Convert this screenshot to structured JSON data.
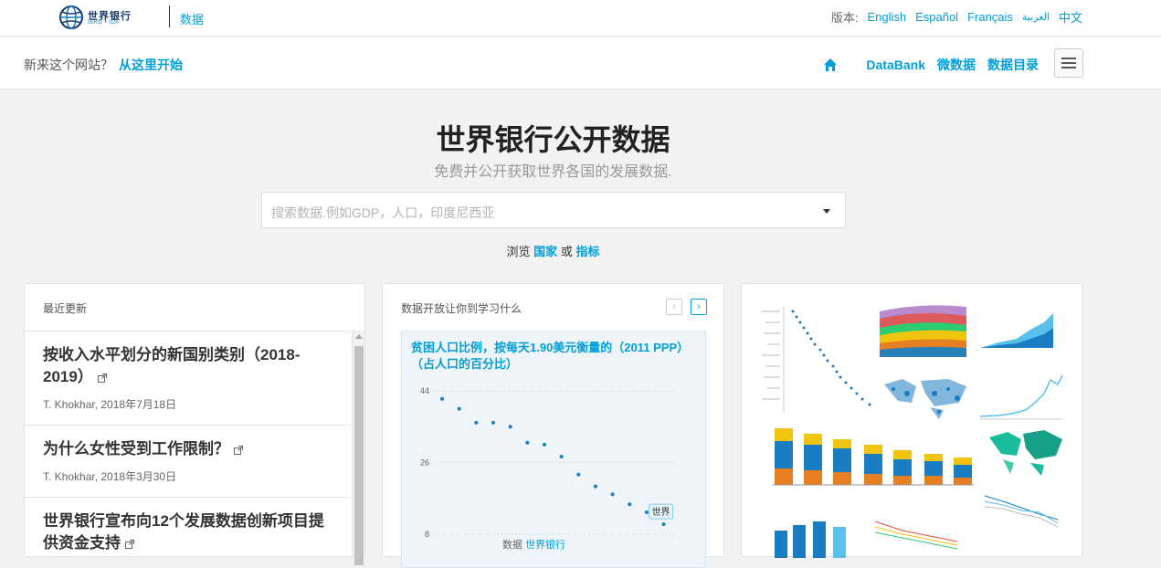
{
  "header": {
    "logo_name": "世界银行",
    "logo_sub": "IBRD • IDA",
    "site_name": "数据",
    "version_label": "版本:",
    "languages": [
      "English",
      "Español",
      "Français",
      "العربية",
      "中文"
    ]
  },
  "subnav": {
    "new_prefix": "新来这个网站？",
    "new_link": "从这里开始",
    "links": [
      "DataBank",
      "微数据",
      "数据目录"
    ]
  },
  "hero": {
    "title": "世界银行公开数据",
    "subtitle": "免费并公开获取世界各国的发展数据.",
    "search_placeholder": "搜索数据.例如GDP，人口，印度尼西亚",
    "browse_prefix": "浏览",
    "browse_countries": "国家",
    "browse_or": "或",
    "browse_indicators": "指标"
  },
  "recent": {
    "heading": "最近更新",
    "items": [
      {
        "title": "按收入水平划分的新国别类别（2018-2019）",
        "meta": "T. Khokhar, 2018年7月18日"
      },
      {
        "title": "为什么女性受到工作限制？",
        "meta": "T. Khokhar, 2018年3月30日"
      },
      {
        "title": "世界银行宣布向12个发展数据创新项目提供资金支持",
        "meta": ""
      }
    ]
  },
  "learn": {
    "heading": "数据开放让你到学习什么",
    "prev": "‹",
    "next": "›",
    "chart_source_prefix": "数据",
    "chart_source_link": "世界银行"
  },
  "chart_data": {
    "type": "scatter",
    "title": "贫困人口比例，按每天1.90美元衡量的（2011 PPP）（占人口的百分比）",
    "y_ticks": [
      "44",
      "26",
      "8"
    ],
    "ylim": [
      8,
      44
    ],
    "y": [
      42,
      39.5,
      36,
      36,
      35,
      31,
      30.5,
      27.5,
      23,
      20,
      18,
      15.5,
      13.5,
      10.5
    ],
    "point_label": "世界"
  },
  "colors": {
    "accent": "#009fda",
    "dark_blue": "#1a3a6c"
  },
  "icons": {
    "home": "home-icon",
    "menu": "hamburger-icon",
    "external": "external-link-icon"
  }
}
